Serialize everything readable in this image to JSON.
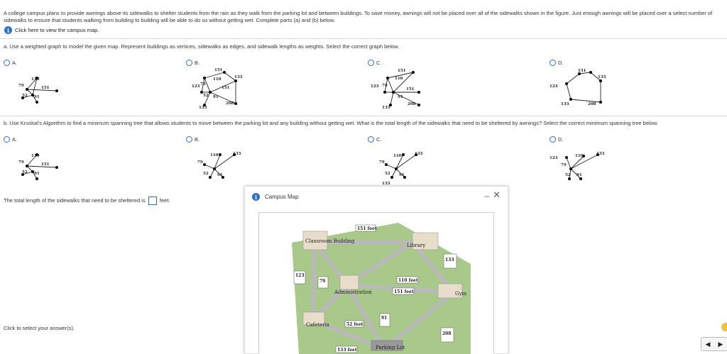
{
  "intro": "A college campus plans to provide awnings above its sidewalks to shelter students from the rain as they walk from the parking lot and between buildings. To save money, awnings will not be placed over all of the sidewalks shown in the figure. Just enough awnings will be placed over a select number of sidewalks to ensure that students walking from building to building will be able to do so without getting wet. Complete parts (a) and (b) below.",
  "campus_link": "Click here to view the campus map.",
  "part_a": "a. Use a weighted graph to model the given map. Represent buildings as vertices, sidewalks as edges, and sidewalk lengths as weights. Select the correct graph below.",
  "part_b": "b. Use Kruskal's Algorithm to find a minimum spanning tree that allows students to move between the parking lot and any building without getting wet. What is the total length of the sidewalks that need to be sheltered by awnings? Select the correct minimum spanning tree below.",
  "options": [
    "A.",
    "B.",
    "C.",
    "D."
  ],
  "answer_prefix": "The total length of the sidewalks that need to be sheltered is",
  "answer_suffix": "feet.",
  "footer": "Click to select your answer(s).",
  "modal": {
    "title": "Campus Map",
    "minimize": "–",
    "close": "✕"
  },
  "map": {
    "buildings": [
      "Classroom Building",
      "Library",
      "Administration",
      "Gym",
      "Cafeteria",
      "Parking Lot"
    ],
    "edges": [
      "151 feet",
      "133 feet",
      "123 feet",
      "79 feet",
      "110 feet",
      "151 feet",
      "52 feet",
      "91 feet",
      "208 feet",
      "133 feet"
    ]
  },
  "weights": {
    "w151": "151",
    "w133": "133",
    "w110": "110",
    "w123": "123",
    "w79": "79",
    "w52": "52",
    "w91": "91",
    "w208": "208"
  },
  "colors": {
    "accent": "#2a6fc9",
    "grass": "#a9c98a",
    "path": "#b9b9b9"
  }
}
